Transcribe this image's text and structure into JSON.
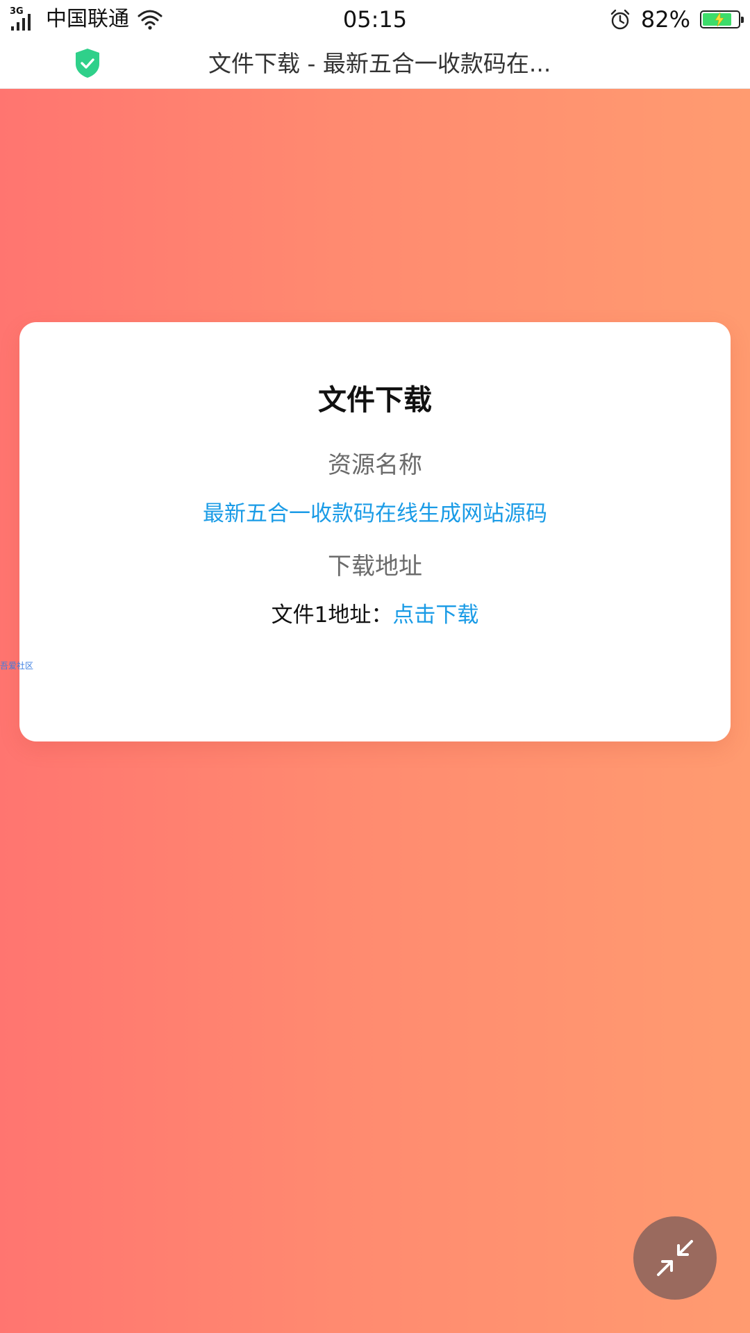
{
  "status_bar": {
    "network_type": "3G",
    "carrier": "中国联通",
    "time": "05:15",
    "battery_percent": "82%",
    "battery_level": 0.82,
    "icons": [
      "signal-icon",
      "wifi-icon",
      "alarm-icon",
      "battery-icon",
      "charging-bolt-icon"
    ]
  },
  "title_bar": {
    "title": "文件下载 - 最新五合一收款码在...",
    "security_icon": "shield-check-icon",
    "security_color": "#2fd08a"
  },
  "card": {
    "title": "文件下载",
    "resource_name_label": "资源名称",
    "resource_name": "最新五合一收款码在线生成网站源码",
    "download_address_label": "下载地址",
    "file_label": "文件1地址：",
    "download_link_text": "点击下载"
  },
  "watermark": {
    "text": "吾爱社区"
  },
  "fab": {
    "icon": "collapse-arrows-icon"
  },
  "colors": {
    "gradient_start": "#ff7570",
    "gradient_end": "#ff9b70",
    "link": "#1a9be6",
    "fab": "#9a6a5e"
  }
}
